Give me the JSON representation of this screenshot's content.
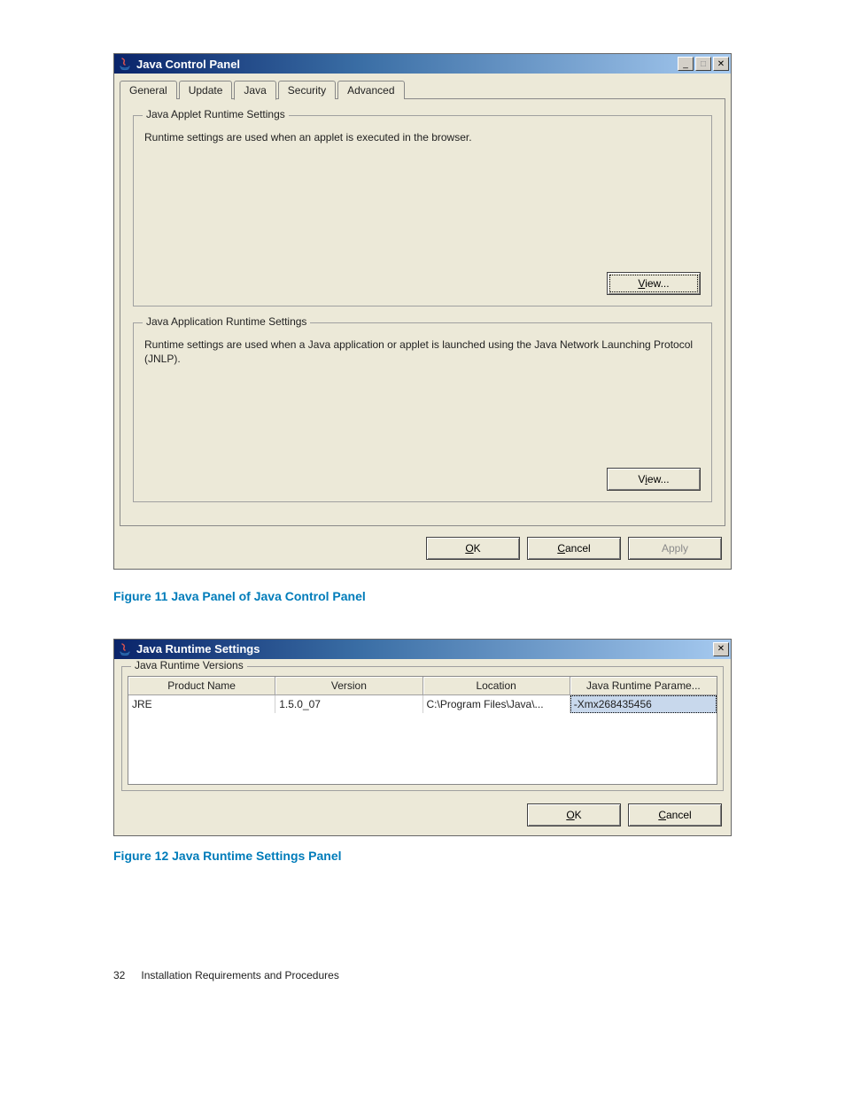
{
  "window1": {
    "title": "Java Control Panel",
    "tabs": [
      "General",
      "Update",
      "Java",
      "Security",
      "Advanced"
    ],
    "active_tab_index": 2,
    "group_applet": {
      "legend": "Java Applet Runtime Settings",
      "body": "Runtime settings are used when an applet is executed in the browser.",
      "view_label": "View..."
    },
    "group_app": {
      "legend": "Java Application Runtime Settings",
      "body": "Runtime settings are used when a Java application or applet is launched using the Java Network Launching Protocol (JNLP).",
      "view_label": "View..."
    },
    "buttons": {
      "ok": "OK",
      "cancel": "Cancel",
      "apply": "Apply"
    }
  },
  "caption1": "Figure 11 Java Panel of Java Control Panel",
  "window2": {
    "title": "Java Runtime Settings",
    "group_legend": "Java Runtime Versions",
    "columns": [
      "Product Name",
      "Version",
      "Location",
      "Java Runtime Parame..."
    ],
    "row": {
      "product": "JRE",
      "version": "1.5.0_07",
      "location": "C:\\Program Files\\Java\\...",
      "params": "-Xmx268435456"
    },
    "buttons": {
      "ok": "OK",
      "cancel": "Cancel"
    }
  },
  "caption2": "Figure 12 Java Runtime Settings Panel",
  "footer": {
    "page": "32",
    "section": "Installation Requirements and Procedures"
  }
}
